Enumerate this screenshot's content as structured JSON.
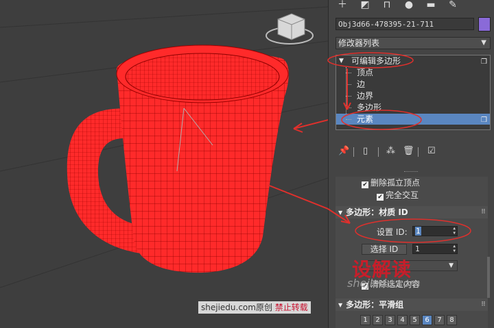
{
  "toolbar": {
    "icons": [
      "create-icon",
      "modify-icon",
      "hierarchy-icon",
      "motion-icon",
      "display-icon",
      "utilities-icon"
    ]
  },
  "object": {
    "name": "Obj3d66-478395-21-711",
    "color": "#8a6ad8"
  },
  "modifier_list": {
    "label": "修改器列表"
  },
  "stack": {
    "root": "可编辑多边形",
    "items": [
      "顶点",
      "边",
      "边界",
      "多边形",
      "元素"
    ],
    "selected_index": 4
  },
  "checkboxes": {
    "ignore_backfacing": "删除孤立顶点",
    "full_interactivity": "完全交互"
  },
  "material_rollout": {
    "title": "多边形：材质 ID",
    "set_id_label": "设置 ID:",
    "set_id_value": "1",
    "select_id_button": "选择 ID",
    "select_id_value": "1",
    "clear_selection": "清除选定内容"
  },
  "smoothing_rollout": {
    "title": "多边形：平滑组",
    "groups": [
      "1",
      "2",
      "3",
      "4",
      "5",
      "6",
      "7",
      "8"
    ],
    "active_group": 5
  },
  "watermark": {
    "brand": "设解读",
    "site": "shejiedu.com"
  },
  "credit": {
    "text": "shejiedu.com原创",
    "warning": "禁止转载"
  },
  "colors": {
    "mesh": "#ff2a2a",
    "selection": "#5a86c0",
    "annotation": "#e0302c",
    "object_color": "#8a6ad8"
  }
}
